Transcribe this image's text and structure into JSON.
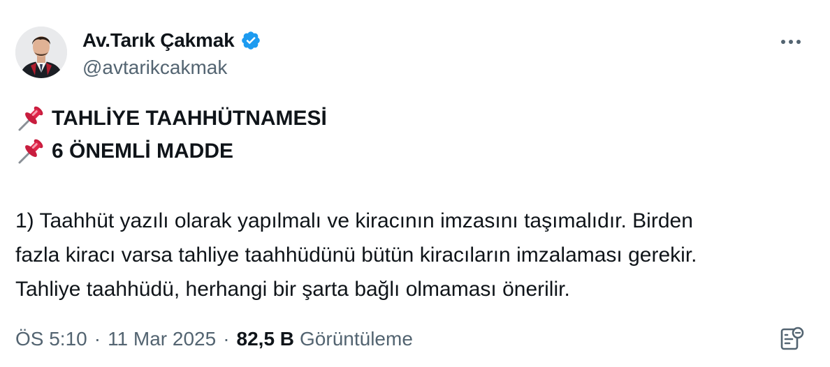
{
  "author": {
    "display_name": "Av.Tarık Çakmak",
    "handle": "@avtarikcakmak",
    "verified": true
  },
  "tweet": {
    "headline_1": "TAHLİYE TAAHHÜTNAMESİ",
    "headline_2": "6 ÖNEMLİ MADDE",
    "body_lines": [
      "1) Taahhüt yazılı olarak yapılmalı ve kiracının imzasını taşımalıdır. Birden",
      "fazla kiracı varsa tahliye taahhüdünü bütün kiracıların imzalaması gerekir.",
      "Tahliye taahhüdü, herhangi bir şarta bağlı olmaması önerilir."
    ]
  },
  "meta": {
    "time": "ÖS 5:10",
    "separator": "·",
    "date": "11 Mar 2025",
    "views_count": "82,5 B",
    "views_label": "Görüntüleme"
  },
  "icons": {
    "pin": "pushpin-icon",
    "verified": "verified-badge-icon",
    "more": "more-options-icon",
    "analytics": "view-analytics-icon"
  },
  "colors": {
    "text_primary": "#0f1419",
    "text_secondary": "#536471",
    "verified_blue": "#1d9bf0",
    "pin_red": "#e0264a"
  }
}
